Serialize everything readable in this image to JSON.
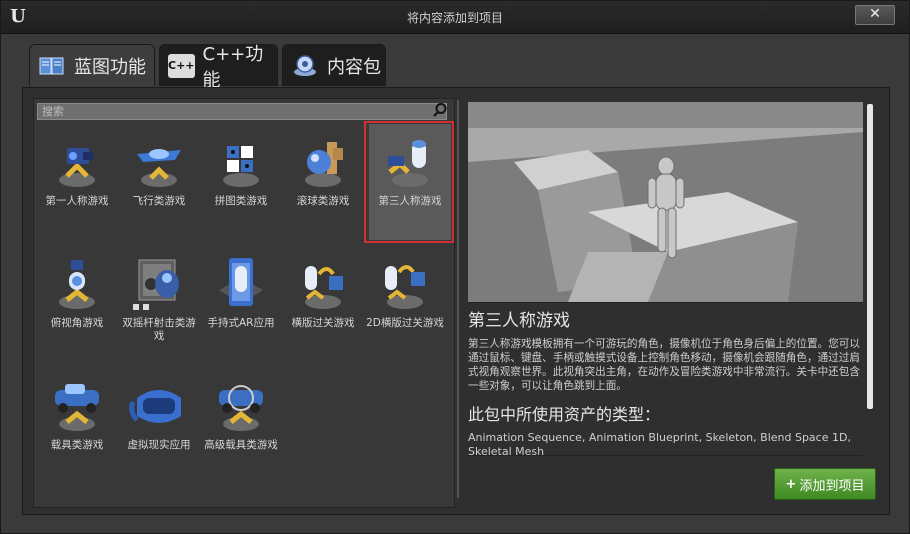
{
  "window": {
    "title": "将内容添加到项目",
    "close_symbol": "✕"
  },
  "tabs": [
    {
      "label": "蓝图功能",
      "icon": "blueprint-book-icon",
      "active": true
    },
    {
      "label": "C++功能",
      "icon": "cpp-icon",
      "active": false
    },
    {
      "label": "内容包",
      "icon": "content-pack-icon",
      "active": false
    }
  ],
  "search": {
    "placeholder": "搜索"
  },
  "templates": [
    {
      "label": "第一人称游戏",
      "icon": "first-person-icon"
    },
    {
      "label": "飞行类游戏",
      "icon": "flying-icon"
    },
    {
      "label": "拼图类游戏",
      "icon": "puzzle-icon"
    },
    {
      "label": "滚球类游戏",
      "icon": "rolling-icon"
    },
    {
      "label": "第三人称游戏",
      "icon": "third-person-icon",
      "selected": true
    },
    {
      "label": "俯视角游戏",
      "icon": "top-down-icon"
    },
    {
      "label": "双摇杆射击类游戏",
      "icon": "twin-stick-icon"
    },
    {
      "label": "手持式AR应用",
      "icon": "handheld-ar-icon"
    },
    {
      "label": "横版过关游戏",
      "icon": "side-scroller-icon"
    },
    {
      "label": "2D横版过关游戏",
      "icon": "2d-side-scroller-icon"
    },
    {
      "label": "载具类游戏",
      "icon": "vehicle-icon"
    },
    {
      "label": "虚拟现实应用",
      "icon": "vr-icon"
    },
    {
      "label": "高级载具类游戏",
      "icon": "advanced-vehicle-icon"
    }
  ],
  "detail": {
    "title": "第三人称游戏",
    "description": "第三人称游戏模板拥有一个可游玩的角色，摄像机位于角色身后偏上的位置。您可以通过鼠标、键盘、手柄或触摸式设备上控制角色移动，摄像机会跟随角色，通过过肩式视角观察世界。此视角突出主角，在动作及冒险类游戏中非常流行。关卡中还包含一些对象，可以让角色跳到上面。",
    "assets_heading": "此包中所使用资产的类型：",
    "assets": "Animation Sequence, Animation Blueprint, Skeleton, Blend Space 1D, Skeletal Mesh"
  },
  "add_button": {
    "label": "添加到项目",
    "plus": "+"
  },
  "colors": {
    "selection_border": "#d03030",
    "add_button": "#4f9a2f"
  }
}
